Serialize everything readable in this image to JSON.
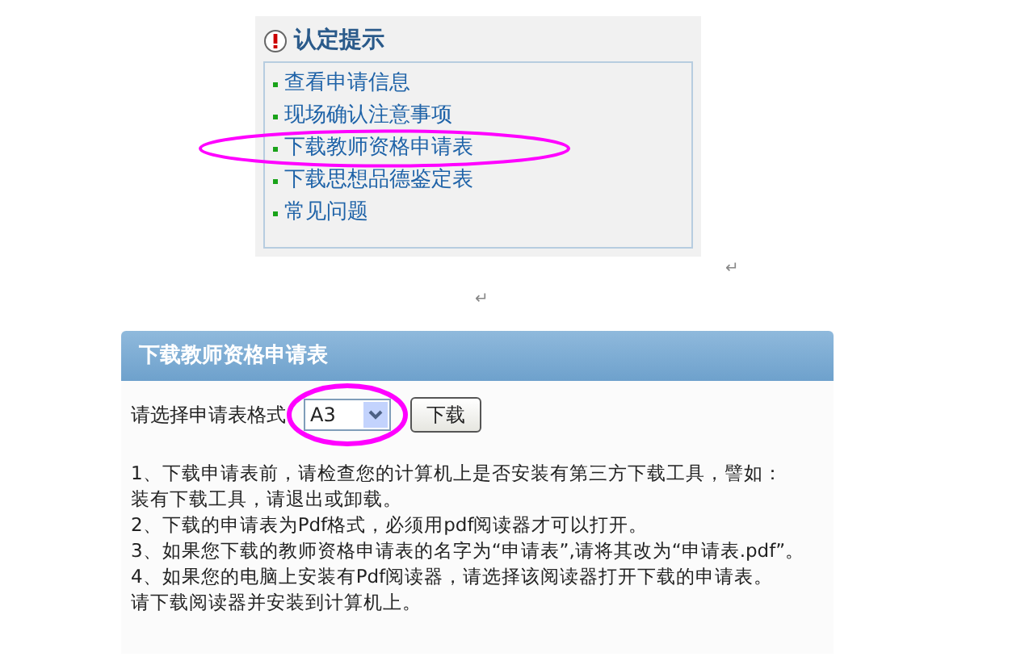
{
  "tips": {
    "title": "认定提示",
    "items": [
      {
        "label": "查看申请信息"
      },
      {
        "label": "现场确认注意事项"
      },
      {
        "label": "下载教师资格申请表"
      },
      {
        "label": "下载思想品德鉴定表"
      },
      {
        "label": "常见问题"
      }
    ]
  },
  "paragraph_marks": [
    "↵",
    "↵"
  ],
  "download_panel": {
    "title": "下载教师资格申请表",
    "format_label": "请选择申请表格式",
    "format_value": "A3",
    "button": "下载",
    "notes": [
      "1、下载申请表前，请检查您的计算机上是否安装有第三方下载工具，譬如：",
      "装有下载工具，请退出或卸载。",
      "2、下载的申请表为Pdf格式，必须用pdf阅读器才可以打开。",
      "3、如果您下载的教师资格申请表的名字为“申请表”,请将其改为“申请表.pdf”。",
      "4、如果您的电脑上安装有Pdf阅读器，请选择该阅读器打开下载的申请表。",
      "请下载阅读器并安装到计算机上。"
    ]
  }
}
